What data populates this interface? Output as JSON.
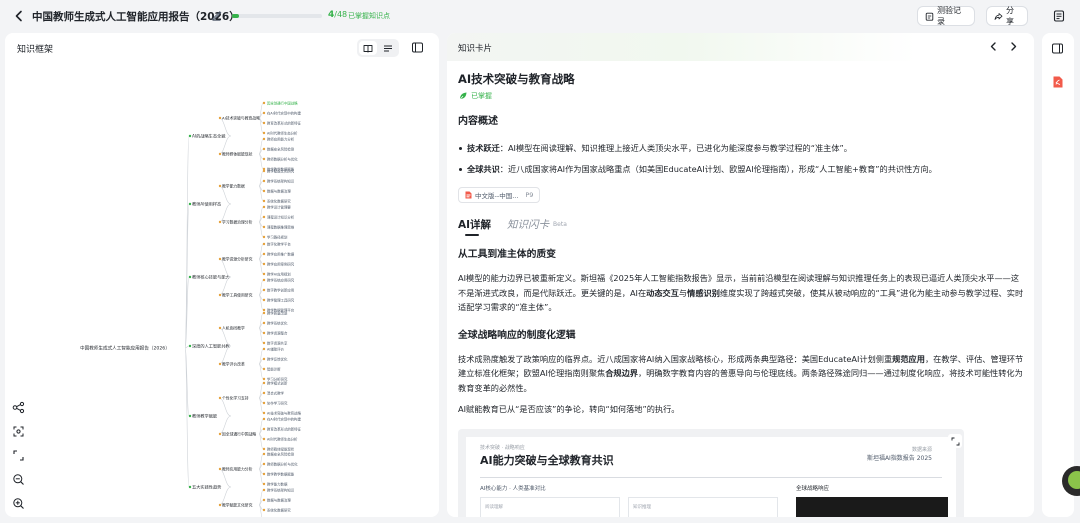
{
  "header": {
    "title": "中国教师生成式人工智能应用报告（2026）",
    "progress": {
      "current": "4",
      "total_text": "/48",
      "label": "已掌握知识点",
      "fraction": 0.083
    },
    "test_label": "测验记录",
    "share_label": "分享"
  },
  "left_panel": {
    "title": "知识框架",
    "mindmap": {
      "root": "中国教师生成式人工智能应用报告（2026）",
      "branches": [
        "AI的战略生态全貌",
        "教师AI使用样态",
        "教师核心技能与能力",
        "深度的人工智能共教",
        "教师教学赋能",
        "五大实践性趋势"
      ],
      "leaves": [
        "AI技术突破与教育战略",
        "因全球通行中国战略",
        "在AI时代实现中的构建",
        "教育改革形式的新特征",
        "AI时代教师生态分析",
        "教师群体赋能现状",
        "教师应用能力分析",
        "数据安全风险检测",
        "教师数据分析与优化",
        "数学教学数据赋能",
        "教学能力数据",
        "教学赋能文化研究",
        "教学系统架构知识",
        "数据与数据治理",
        "系统化数据研究",
        "学习数据治理分析",
        "教学设计管理要",
        "课程设计知识分析",
        "课程数据推理思维",
        "学习路径规划",
        "教学资源分析研究",
        "数字化教学平台",
        "教学应用推广数据",
        "教学应用案例研究",
        "教学AI应用规划",
        "教学工具使用研究",
        "教学系统应用研究",
        "数字教学创新应用",
        "教学管理工具研究",
        "教学数据管理平台",
        "人机协同教学",
        "教学质量改进",
        "教学系统优化",
        "教学资源整合",
        "数字资源共享",
        "教学评价改革",
        "AI辅助评价",
        "教学反馈优化",
        "智能诊断",
        "学习分析研究",
        "个性化学习支持",
        "教学模式创新",
        "混合式教学",
        "协作学习研究"
      ]
    }
  },
  "card": {
    "label": "知识卡片",
    "title": "AI技术突破与教育战略",
    "status": "已掌握",
    "overview_heading": "内容概述",
    "bullets": [
      {
        "term": "技术跃迁",
        "text": "：AI模型在阅读理解、知识推理上接近人类顶尖水平，已进化为能深度参与教学过程的“准主体”。"
      },
      {
        "term": "全球共识",
        "text": "：近八成国家将AI作为国家战略重点（如美国EducateAI计划、欧盟AI伦理指南），形成“人工智能+教育”的共识性方向。"
      }
    ],
    "source_chip": {
      "name": "中文版--中国...",
      "page": "P9"
    },
    "tabs": {
      "detail": "AI详解",
      "flash": "知识闪卡",
      "beta": "Beta"
    },
    "section1": {
      "title": "从工具到准主体的质变",
      "p_a": "AI模型的能力边界已被重新定义。斯坦福《2025年人工智能指数报告》显示，当前前沿模型在阅读理解与知识推理任务上的表现已逼近人类顶尖水平——这不是渐进式改良，而是代际跃迁。更关键的是，AI在",
      "p_b1": "动态交互",
      "p_c": "与",
      "p_b2": "情感识别",
      "p_d": "维度实现了跨越式突破，使其从被动响应的“工具”进化为能主动参与教学过程、实时适配学习需求的“准主体”。"
    },
    "section2": {
      "title": "全球战略响应的制度化逻辑",
      "p_a": "技术成熟度触发了政策响应的临界点。近八成国家将AI纳入国家战略核心，形成两条典型路径：美国EducateAI计划侧重",
      "p_b1": "规范应用",
      "p_c": "，在教学、评估、管理环节建立标准化框架；欧盟AI伦理指南则聚焦",
      "p_b2": "合规边界",
      "p_d": "，明确数字教育内容的普惠导向与伦理底线。两条路径殊途同归——通过制度化响应，将技术可能性转化为教育变革的必然性。",
      "p2": "AI赋能教育已从“是否应该”的争论，转向“如何落地”的执行。"
    },
    "figure": {
      "subtitle": "技术突破 · 战略响应",
      "title": "AI能力突破与全球教育共识",
      "right_small": "数据来源",
      "right_text": "斯坦福AI指数报告 2025",
      "left_section": "AI核心能力 · 人类基准对比",
      "right_section": "全球战略响应",
      "box1_label": "阅读理解",
      "box2_label": "知识推理"
    }
  },
  "colors": {
    "accent_green": "#35b24a",
    "pdf_red": "#f25a4a"
  }
}
